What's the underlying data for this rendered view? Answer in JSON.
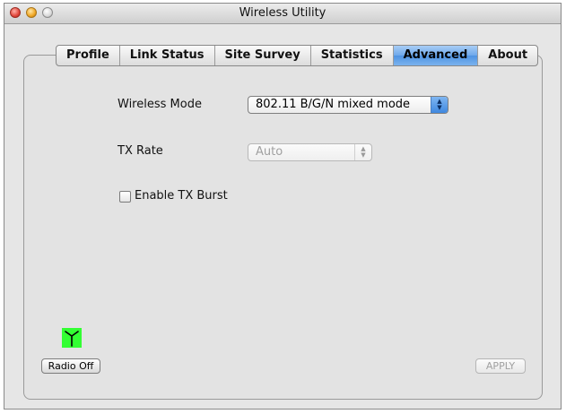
{
  "window": {
    "title": "Wireless Utility"
  },
  "tabs": [
    {
      "label": "Profile"
    },
    {
      "label": "Link Status"
    },
    {
      "label": "Site Survey"
    },
    {
      "label": "Statistics"
    },
    {
      "label": "Advanced",
      "active": true
    },
    {
      "label": "About"
    }
  ],
  "advanced": {
    "wireless_mode_label": "Wireless Mode",
    "wireless_mode_value": "802.11 B/G/N mixed mode",
    "tx_rate_label": "TX Rate",
    "tx_rate_value": "Auto",
    "tx_burst_label": "Enable TX Burst",
    "tx_burst_checked": false
  },
  "footer": {
    "radio_button": "Radio Off",
    "apply_button": "APPLY",
    "antenna_status_color": "#33ff33"
  },
  "icons": {
    "select_arrows": "up-down-arrows-icon",
    "antenna": "antenna-icon"
  }
}
